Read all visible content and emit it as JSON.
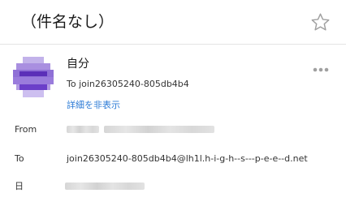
{
  "header": {
    "subject": "（件名なし）",
    "star_icon": "star-outline-icon"
  },
  "sender": {
    "name": "自分",
    "to_line": "To join26305240-805db4b4",
    "hide_details": "詳細を非表示",
    "avatar_colors": [
      "#6b3fc9",
      "#8a5ad8",
      "#b39be3",
      "#5b2fb8"
    ],
    "more_icon": "more-horizontal-icon"
  },
  "details": {
    "from_label": "From",
    "to_label": "To",
    "to_value": "join26305240-805db4b4@lh1l.h-i-g-h--s---p-e-e--d.net",
    "date_label": "日"
  },
  "colors": {
    "link": "#2c7bd6",
    "icon_gray": "#a0a0a0",
    "divider": "#e4e4e4"
  }
}
